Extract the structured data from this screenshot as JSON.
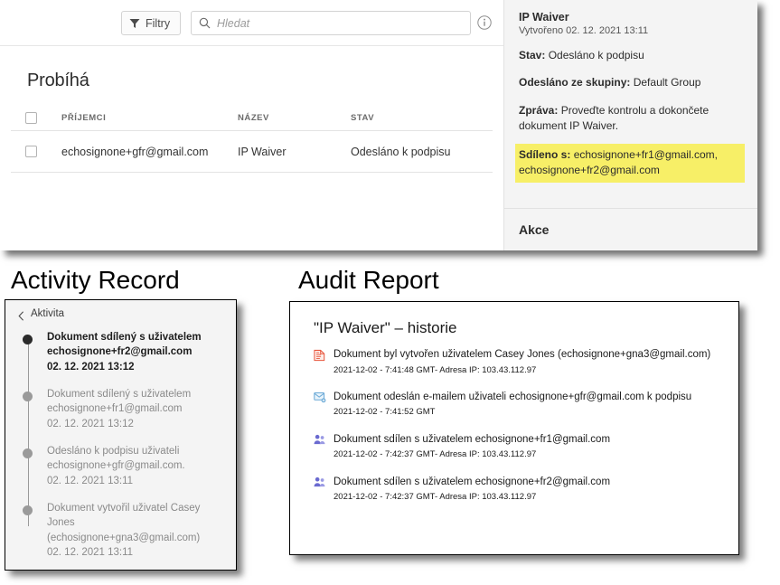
{
  "toolbar": {
    "filter_label": "Filtry",
    "filter_icon": "funnel-icon",
    "search_placeholder": "Hledat",
    "search_value": "",
    "search_icon": "search-icon",
    "info_icon": "info-circle-icon"
  },
  "list": {
    "section_title": "Probíhá",
    "columns": [
      "PŘÍJEMCI",
      "NÁZEV",
      "STAV"
    ],
    "rows": [
      {
        "recipient": "echosignone+gfr@gmail.com",
        "name": "IP Waiver",
        "state": "Odesláno k podpisu"
      }
    ]
  },
  "detail": {
    "title": "IP Waiver",
    "created": "Vytvořeno 02. 12. 2021 13:11",
    "state_label": "Stav:",
    "state_value": "Odesláno k podpisu",
    "group_label": "Odesláno ze skupiny:",
    "group_value": "Default Group",
    "message_label": "Zpráva:",
    "message_value": "Proveďte kontrolu a dokončete dokument IP Waiver.",
    "shared_label": "Sdíleno s:",
    "shared_value": "echosignone+fr1@gmail.com, echosignone+fr2@gmail.com",
    "shared_highlight_color": "#f7ef67",
    "actions_label": "Akce"
  },
  "activity_heading": "Activity Record",
  "audit_heading": "Audit Report",
  "activity": {
    "back_label": "Aktivita",
    "back_icon": "chevron-left-icon",
    "items": [
      {
        "text": "Dokument sdílený s uživatelem echosignone+fr2@gmail.com",
        "time": "02. 12. 2021 13:12",
        "active": true
      },
      {
        "text": "Dokument sdílený s uživatelem echosignone+fr1@gmail.com",
        "time": "02. 12. 2021 13:12",
        "active": false
      },
      {
        "text": "Odesláno k podpisu uživateli echosignone+gfr@gmail.com.",
        "time": "02. 12. 2021 13:11",
        "active": false
      },
      {
        "text": "Dokument vytvořil uživatel Casey Jones (echosignone+gna3@gmail.com)",
        "time": "02. 12. 2021 13:11",
        "active": false
      }
    ]
  },
  "audit": {
    "title": "\"IP Waiver\" – historie",
    "events": [
      {
        "icon": "document-created-icon",
        "text": "Dokument byl vytvořen uživatelem Casey Jones (echosignone+gna3@gmail.com)",
        "meta": "2021-12-02 - 7:41:48 GMT- Adresa IP: 103.43.112.97"
      },
      {
        "icon": "email-sent-icon",
        "text": "Dokument odeslán e-mailem uživateli echosignone+gfr@gmail.com k podpisu",
        "meta": "2021-12-02 - 7:41:52 GMT"
      },
      {
        "icon": "document-shared-icon",
        "text": "Dokument sdílen s uživatelem echosignone+fr1@gmail.com",
        "meta": "2021-12-02 - 7:42:37 GMT- Adresa IP: 103.43.112.97"
      },
      {
        "icon": "document-shared-icon",
        "text": "Dokument sdílen s uživatelem echosignone+fr2@gmail.com",
        "meta": "2021-12-02 - 7:42:37 GMT- Adresa IP: 103.43.112.97"
      }
    ]
  }
}
